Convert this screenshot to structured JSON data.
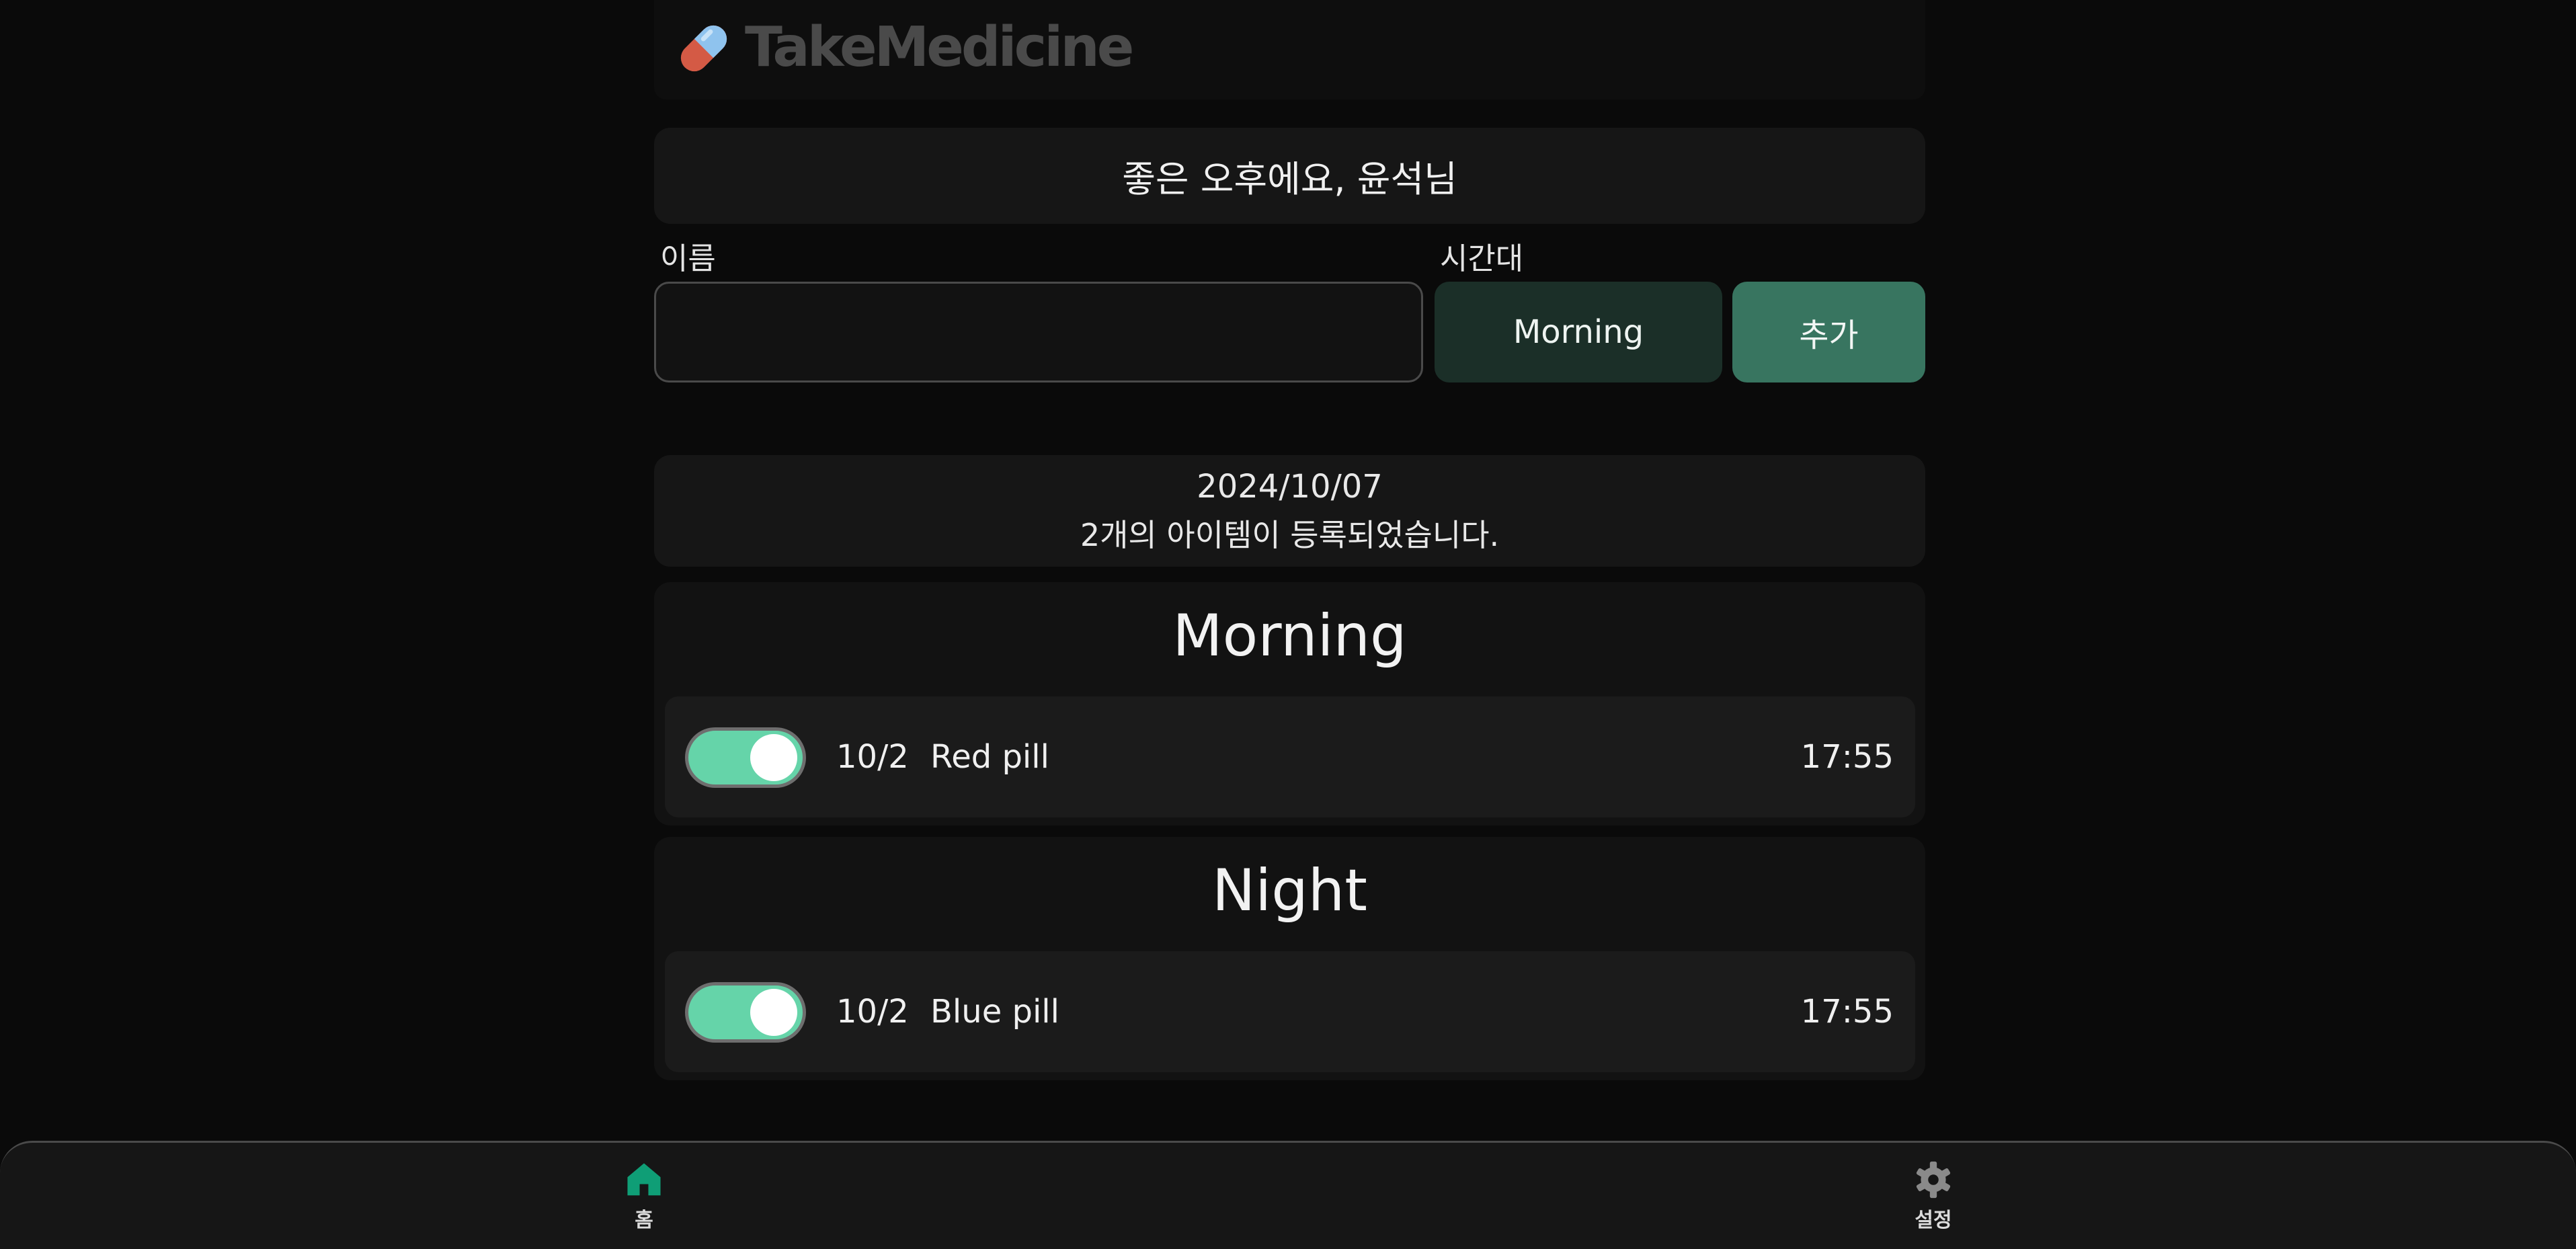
{
  "app": {
    "name": "TakeMedicine"
  },
  "greeting": "좋은 오후에요, 윤석님",
  "form": {
    "name_label": "이름",
    "name_value": "",
    "time_label": "시간대",
    "time_value": "Morning",
    "add_label": "추가"
  },
  "summary": {
    "date": "2024/10/07",
    "count_text": "2개의 아이템이 등록되었습니다."
  },
  "groups": [
    {
      "title": "Morning",
      "items": [
        {
          "checked": true,
          "date": "10/2",
          "name": "Red pill",
          "time": "17:55"
        }
      ]
    },
    {
      "title": "Night",
      "items": [
        {
          "checked": true,
          "date": "10/2",
          "name": "Blue pill",
          "time": "17:55"
        }
      ]
    }
  ],
  "nav": {
    "home_label": "홈",
    "home_icon": "home-icon",
    "settings_label": "설정",
    "settings_icon": "gear-icon"
  },
  "colors": {
    "background": "#0a0a0a",
    "accent": "#387560",
    "toggle_on": "#65d4a9",
    "nav_active": "#0f9e76"
  }
}
